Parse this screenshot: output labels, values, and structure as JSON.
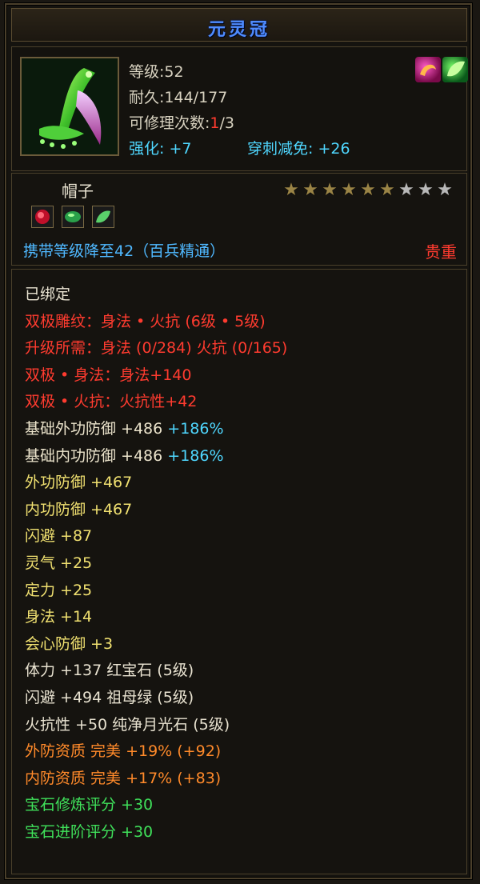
{
  "item": {
    "name": "元灵冠",
    "level_label": "等级:52",
    "durability_label": "耐久:144/177",
    "repair_prefix": "可修理次数:",
    "repair_used": "1",
    "repair_suffix": "/3",
    "enhance_label": "强化: +7",
    "pierce_label": "穿刺减免: +26",
    "type": "帽子",
    "stars_filled": 6,
    "stars_total": 9,
    "requirement": "携带等级降至42（百兵精通）",
    "rarity": "贵重"
  },
  "buff_icons": [
    "swirl-purple-icon",
    "leaf-green-icon"
  ],
  "gem_slots": [
    "red-gem-icon",
    "green-gem-icon",
    "green-jade-icon"
  ],
  "attributes": [
    {
      "text": "已绑定",
      "color": "white"
    },
    {
      "text": "双极雕纹：身法 • 火抗 (6级 • 5级)",
      "color": "red"
    },
    {
      "text": "升级所需：身法 (0/284)  火抗 (0/165)",
      "color": "red"
    },
    {
      "text": "双极 • 身法：身法+140",
      "color": "red"
    },
    {
      "text": "双极 • 火抗：火抗性+42",
      "color": "red"
    },
    {
      "text": "基础外功防御 +486",
      "extra": "+186%",
      "color": "cream"
    },
    {
      "text": "基础内功防御 +486",
      "extra": "+186%",
      "color": "cream"
    },
    {
      "text": "外功防御 +467",
      "color": "yellow"
    },
    {
      "text": "内功防御 +467",
      "color": "yellow"
    },
    {
      "text": "闪避 +87",
      "color": "yellow"
    },
    {
      "text": "灵气 +25",
      "color": "yellow"
    },
    {
      "text": "定力 +25",
      "color": "yellow"
    },
    {
      "text": "身法 +14",
      "color": "yellow"
    },
    {
      "text": "会心防御 +3",
      "color": "yellow"
    },
    {
      "text": "体力 +137 红宝石 (5级)",
      "color": "white"
    },
    {
      "text": "闪避 +494 祖母绿 (5级)",
      "color": "white"
    },
    {
      "text": "火抗性 +50 纯净月光石 (5级)",
      "color": "white"
    },
    {
      "text": "外防资质  完美 +19% (+92)",
      "color": "orange"
    },
    {
      "text": "内防资质  完美 +17% (+83)",
      "color": "orange"
    },
    {
      "text": "宝石修炼评分 +30",
      "color": "green"
    },
    {
      "text": "宝石进阶评分 +30",
      "color": "green"
    }
  ],
  "colors": {
    "title": "#4f8cff",
    "red": "#ff3b2f",
    "cyan": "#4fd7ff",
    "yellow": "#f0e070",
    "orange": "#ff8a2a",
    "green": "#3fe05a",
    "star_gold": "#9a8446",
    "star_grey": "#b8b8b8"
  }
}
